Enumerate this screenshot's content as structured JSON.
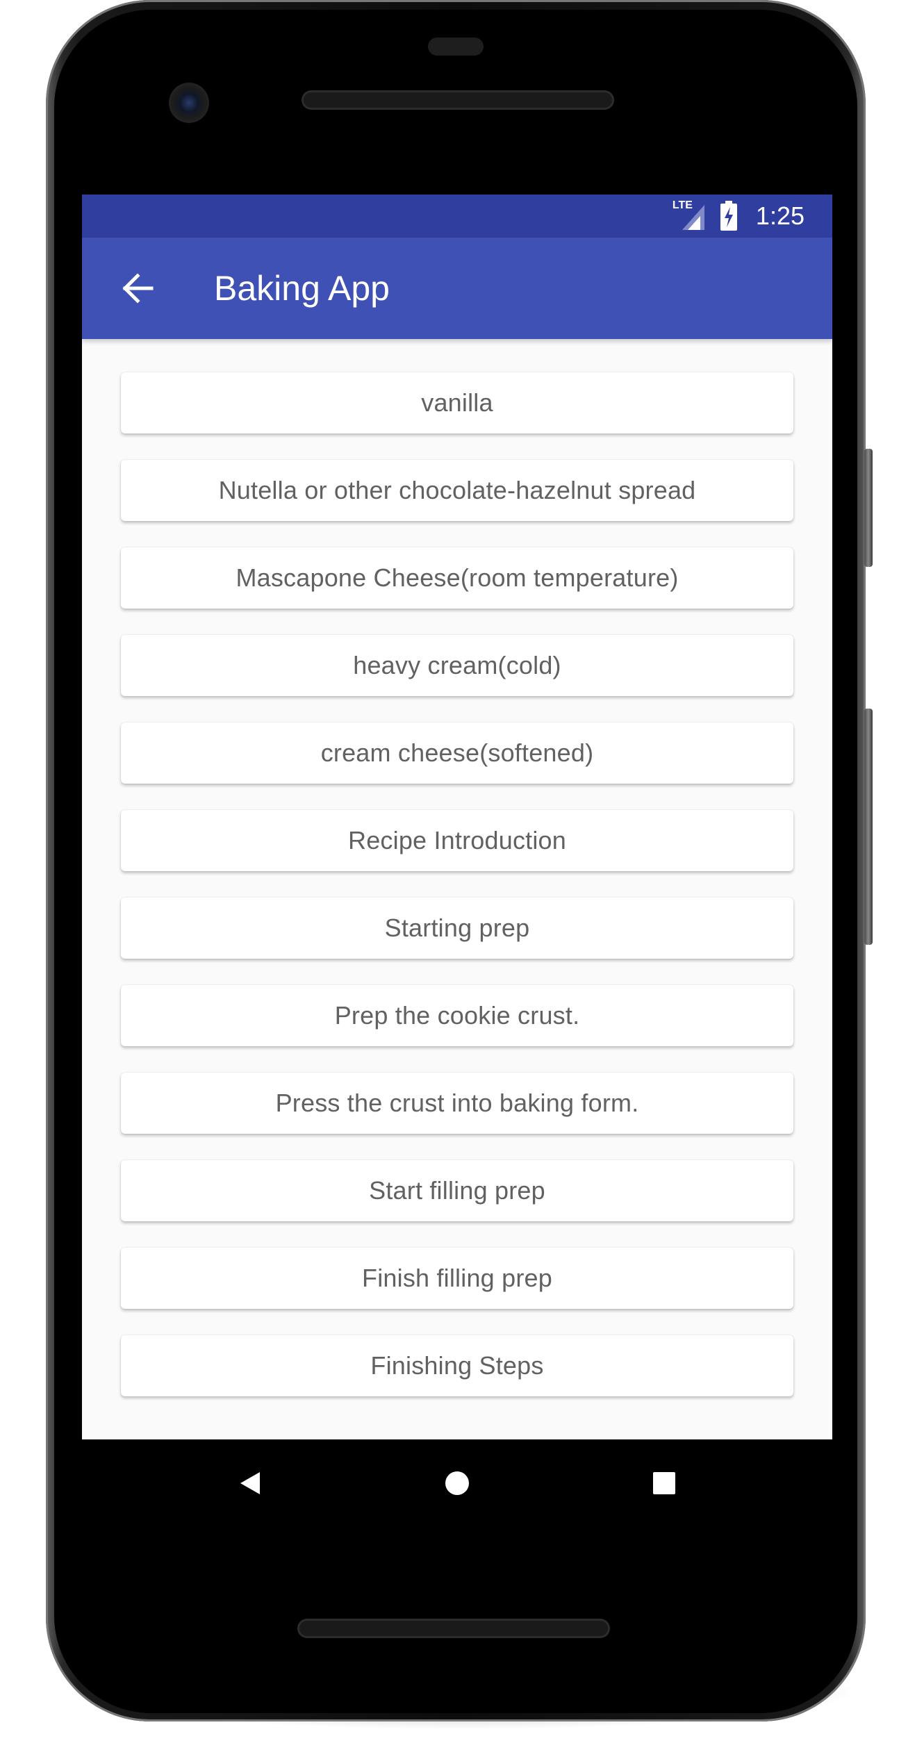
{
  "status_bar": {
    "network_label": "LTE",
    "time": "1:25",
    "signal_icon": "signal-icon",
    "battery_icon": "battery-charging-icon"
  },
  "app_bar": {
    "title": "Baking App",
    "back_icon": "arrow-back-icon"
  },
  "items": [
    {
      "label": "vanilla"
    },
    {
      "label": "Nutella or other chocolate-hazelnut spread"
    },
    {
      "label": "Mascapone Cheese(room temperature)"
    },
    {
      "label": "heavy cream(cold)"
    },
    {
      "label": "cream cheese(softened)"
    },
    {
      "label": "Recipe Introduction"
    },
    {
      "label": "Starting prep"
    },
    {
      "label": "Prep the cookie crust."
    },
    {
      "label": "Press the crust into baking form."
    },
    {
      "label": "Start filling prep"
    },
    {
      "label": "Finish filling prep"
    },
    {
      "label": "Finishing Steps"
    }
  ],
  "nav_bar": {
    "back_icon": "nav-back-icon",
    "home_icon": "nav-home-icon",
    "recents_icon": "nav-recents-icon"
  },
  "colors": {
    "status_bar": "#303f9f",
    "app_bar": "#3f51b5",
    "background": "#fafafa",
    "item_text": "#616161"
  }
}
